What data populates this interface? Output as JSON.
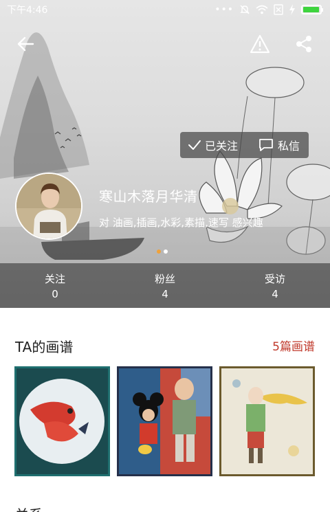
{
  "status_bar": {
    "time": "下午4:46",
    "battery_level": 0.95,
    "icons": [
      "more-dots-icon",
      "mute-icon",
      "wifi-icon",
      "sim-off-icon",
      "charging-icon",
      "battery-icon"
    ]
  },
  "top_bar": {
    "icons": [
      "back-arrow-icon",
      "report-warning-icon",
      "share-icon"
    ]
  },
  "actions": {
    "follow_label": "已关注",
    "message_label": "私信"
  },
  "profile": {
    "name": "寒山木落月华清",
    "interests": "对 油画,插画,水彩,素描,速写 感兴趣"
  },
  "carousel": {
    "pages": 2,
    "active": 1
  },
  "stats": [
    {
      "label": "关注",
      "value": "0"
    },
    {
      "label": "粉丝",
      "value": "4"
    },
    {
      "label": "受访",
      "value": "4"
    }
  ],
  "gallery": {
    "title": "TA的画谱",
    "count_label": "5篇画谱"
  },
  "next_section": {
    "title": "关系"
  },
  "colors": {
    "accent_red": "#c0392b",
    "carousel_active": "#f0a23a",
    "battery_green": "#3ed43e"
  }
}
